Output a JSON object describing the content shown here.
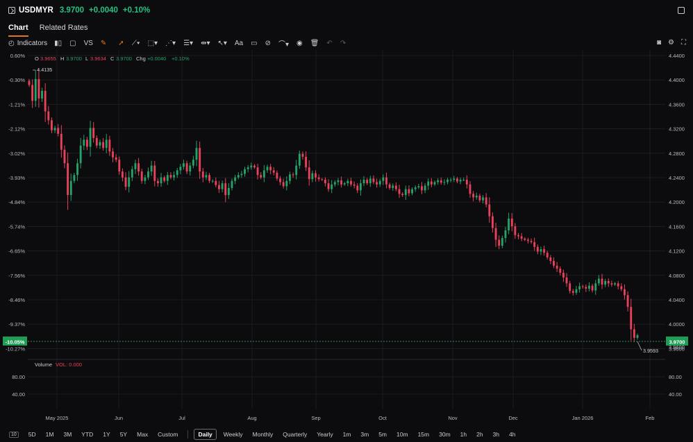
{
  "header": {
    "symbol": "USDMYR",
    "price": "3.9700",
    "change": "+0.0040",
    "change_pct": "+0.10%"
  },
  "tabs": [
    {
      "label": "Chart",
      "active": true
    },
    {
      "label": "Related Rates",
      "active": false
    }
  ],
  "toolbar": {
    "indicators_label": "Indicators",
    "vs_label": "VS",
    "text_tool_label": "Aa",
    "icons": [
      "indicators-icon",
      "candle-type-icon",
      "rectangle-icon",
      "vs-icon",
      "brush-icon",
      "cursor-icon",
      "trendline-icon",
      "shape-icon",
      "pattern-icon",
      "fib-icon",
      "measure-icon",
      "arrow-icon",
      "text-icon",
      "comment-icon",
      "pen-off-icon",
      "magnet-icon",
      "eye-icon",
      "trash-icon",
      "undo-icon",
      "redo-icon"
    ],
    "right_icons": [
      "camera-icon",
      "settings-icon",
      "fullscreen-icon"
    ]
  },
  "ohlc": {
    "o_label": "O",
    "o_value": "3.9655",
    "h_label": "H",
    "h_value": "3.9700",
    "l_label": "L",
    "l_value": "3.9634",
    "c_label": "C",
    "c_value": "3.9700",
    "chg_label": "Chg",
    "chg_value": "+0.0040",
    "chg_pct": "+0.10%"
  },
  "colors": {
    "up": "#26a269",
    "down": "#e8425a",
    "current_price_tag": "#1f9d55",
    "accent": "#e07a21",
    "grid": "#1c1d22"
  },
  "chart_data": {
    "type": "candlestick",
    "x_tick_labels": [
      "May 2025",
      "Jun",
      "Jul",
      "Aug",
      "Sep",
      "Oct",
      "Nov",
      "Dec",
      "Jan 2026",
      "Feb"
    ],
    "y_right_ticks": [
      "4.4400",
      "4.4000",
      "4.3600",
      "4.3200",
      "4.2800",
      "4.2400",
      "4.2000",
      "4.1600",
      "4.1200",
      "4.0800",
      "4.0400",
      "4.0000",
      "3.9600"
    ],
    "y_left_ticks": [
      "0.60%",
      "-0.30%",
      "-1.21%",
      "-2.12%",
      "-3.02%",
      "-3.93%",
      "-4.84%",
      "-5.74%",
      "-6.65%",
      "-7.56%",
      "-8.46%",
      "-9.37%",
      "-10.27%"
    ],
    "ylim": [
      3.95,
      4.445
    ],
    "high_marker": "4.4135",
    "low_marker": "3.9593",
    "current_price": "3.9700",
    "current_pct": "-10.05%",
    "right_edge_label": "3.9600",
    "volume_label": "Volume",
    "volume_value_label": "VOL: 0.000",
    "volume_ticks": [
      "80.00",
      "40.00"
    ],
    "closes": [
      4.395,
      4.368,
      4.405,
      4.372,
      4.385,
      4.35,
      4.335,
      4.318,
      4.322,
      4.312,
      4.285,
      4.262,
      4.208,
      4.232,
      4.242,
      4.262,
      4.292,
      4.302,
      4.29,
      4.322,
      4.305,
      4.292,
      4.298,
      4.288,
      4.302,
      4.282,
      4.272,
      4.268,
      4.248,
      4.238,
      4.222,
      4.238,
      4.252,
      4.262,
      4.248,
      4.232,
      4.238,
      4.248,
      4.258,
      4.232,
      4.228,
      4.238,
      4.232,
      4.242,
      4.238,
      4.242,
      4.25,
      4.256,
      4.262,
      4.248,
      4.258,
      4.268,
      4.288,
      4.248,
      4.238,
      4.242,
      4.232,
      4.232,
      4.225,
      4.218,
      4.228,
      4.208,
      4.22,
      4.232,
      4.238,
      4.242,
      4.244,
      4.252,
      4.255,
      4.258,
      4.255,
      4.242,
      4.238,
      4.25,
      4.256,
      4.25,
      4.246,
      4.236,
      4.23,
      4.223,
      4.232,
      4.243,
      4.242,
      4.258,
      4.278,
      4.273,
      4.255,
      4.235,
      4.245,
      4.238,
      4.235,
      4.234,
      4.228,
      4.218,
      4.226,
      4.23,
      4.233,
      4.226,
      4.228,
      4.232,
      4.226,
      4.224,
      4.216,
      4.228,
      4.234,
      4.228,
      4.236,
      4.23,
      4.226,
      4.232,
      4.238,
      4.226,
      4.22,
      4.224,
      4.218,
      4.21,
      4.208,
      4.218,
      4.211,
      4.218,
      4.221,
      4.223,
      4.216,
      4.224,
      4.231,
      4.226,
      4.23,
      4.233,
      4.229,
      4.23,
      4.234,
      4.234,
      4.236,
      4.231,
      4.234,
      4.234,
      4.226,
      4.21,
      4.204,
      4.207,
      4.199,
      4.204,
      4.192,
      4.172,
      4.152,
      4.132,
      4.122,
      4.135,
      4.148,
      4.168,
      4.155,
      4.14,
      4.138,
      4.134,
      4.132,
      4.13,
      4.128,
      4.12,
      4.112,
      4.116,
      4.11,
      4.102,
      4.096,
      4.088,
      4.083,
      4.076,
      4.068,
      4.058,
      4.045,
      4.042,
      4.048,
      4.053,
      4.052,
      4.049,
      4.054,
      4.046,
      4.058,
      4.066,
      4.056,
      4.062,
      4.058,
      4.056,
      4.058,
      4.053,
      4.048,
      4.038,
      4.018,
      3.98,
      3.9655,
      3.97
    ]
  },
  "bottombar": {
    "ranges": [
      "5D",
      "1M",
      "3M",
      "YTD",
      "1Y",
      "5Y",
      "Max",
      "Custom"
    ],
    "intervals": [
      "Daily",
      "Weekly",
      "Monthly",
      "Quarterly",
      "Yearly",
      "1m",
      "3m",
      "5m",
      "10m",
      "15m",
      "30m",
      "1h",
      "2h",
      "3h",
      "4h"
    ],
    "active_interval": "Daily"
  }
}
